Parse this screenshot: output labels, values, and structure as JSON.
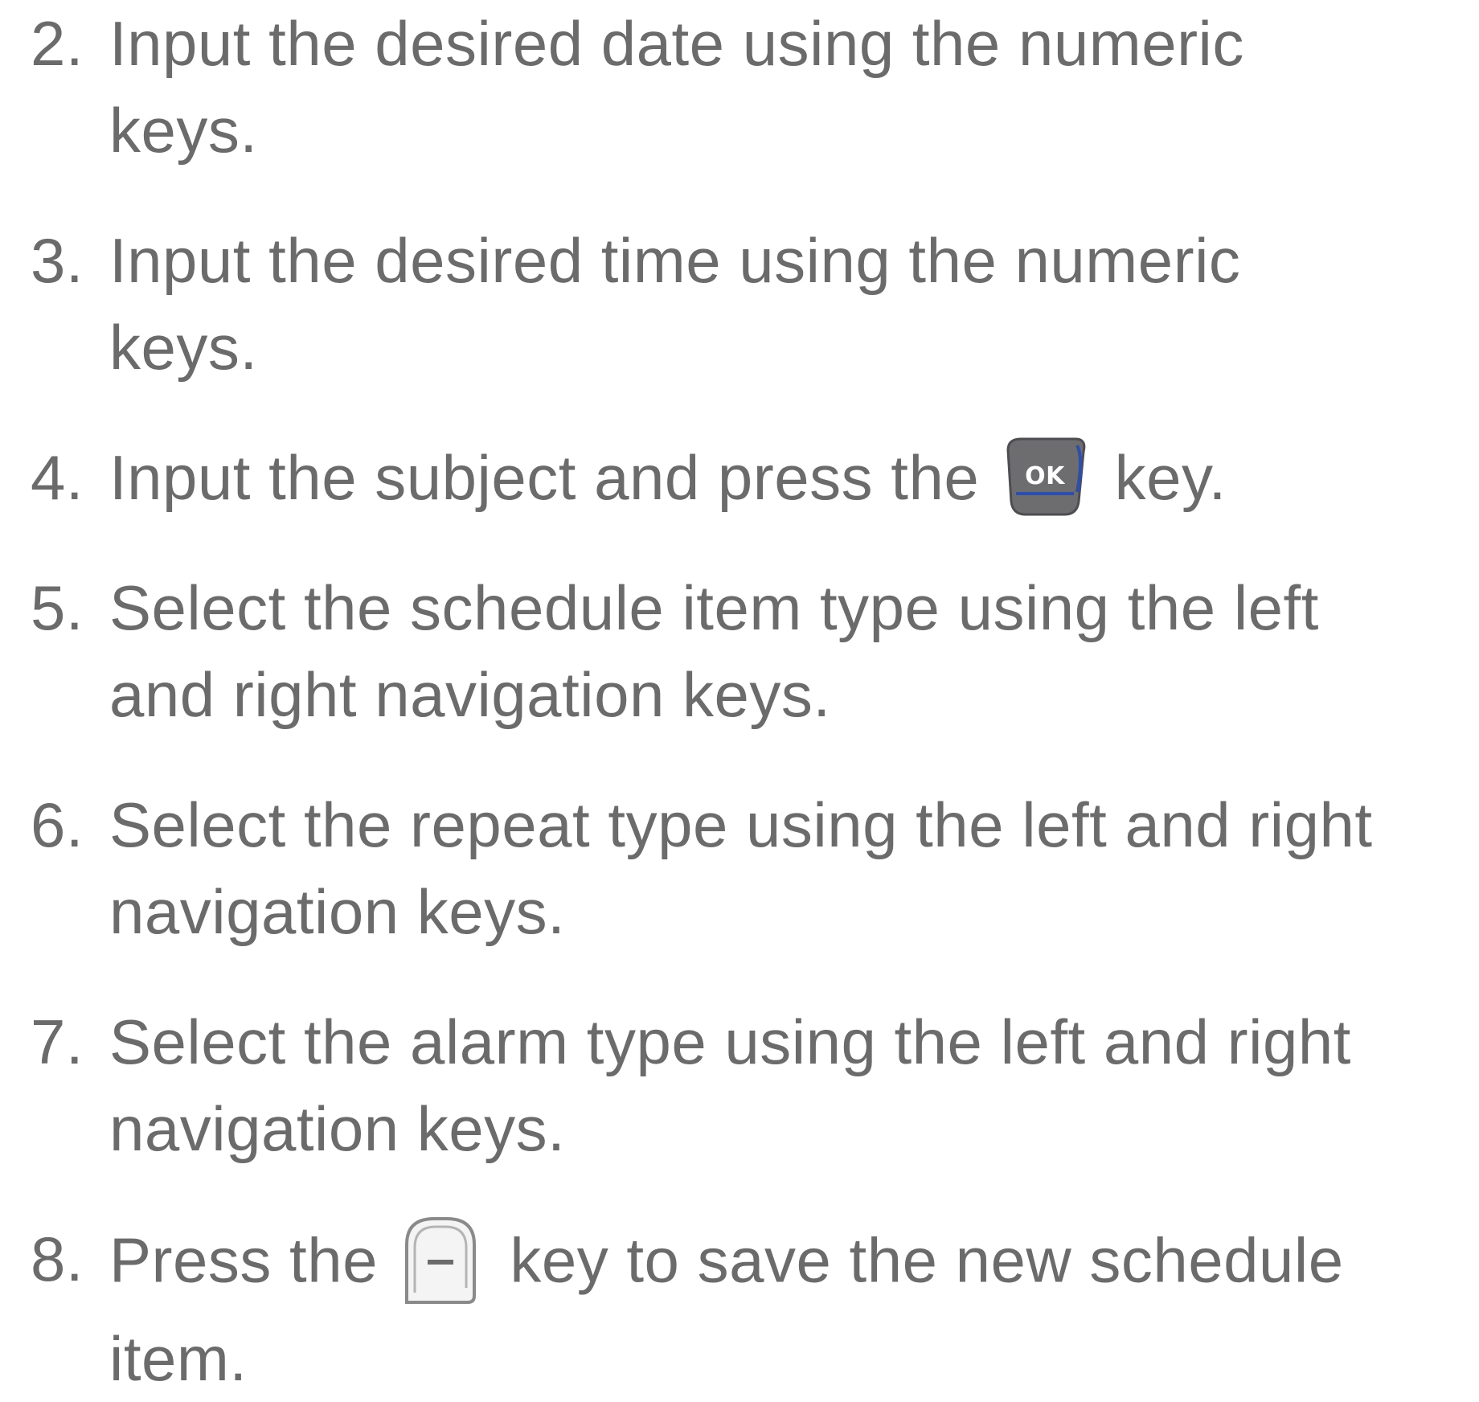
{
  "steps": [
    {
      "number": "2.",
      "line1": "Input the desired date using the numeric",
      "line2": "keys."
    },
    {
      "number": "3.",
      "line1": "Input the desired time using the numeric",
      "line2": "keys."
    },
    {
      "number": "4.",
      "before": "Input the subject and press the",
      "icon_label": "OK",
      "after": "key."
    },
    {
      "number": "5.",
      "line1": "Select the schedule item type using the left",
      "line2": "and right navigation keys."
    },
    {
      "number": "6.",
      "line1": "Select the repeat type using the left and right",
      "line2": "navigation keys."
    },
    {
      "number": "7.",
      "line1": "Select the alarm type using the left and right",
      "line2": "navigation keys."
    },
    {
      "number": "8.",
      "before": "Press the",
      "after": "key to save the new schedule",
      "line2": "item."
    }
  ],
  "icons": {
    "ok_key": "ok-key-icon",
    "soft_key": "left-soft-key-icon"
  },
  "colors": {
    "text": "#6b6b6b",
    "ok_key_fill": "#6d6d70",
    "ok_key_accent": "#2a4fb0"
  }
}
